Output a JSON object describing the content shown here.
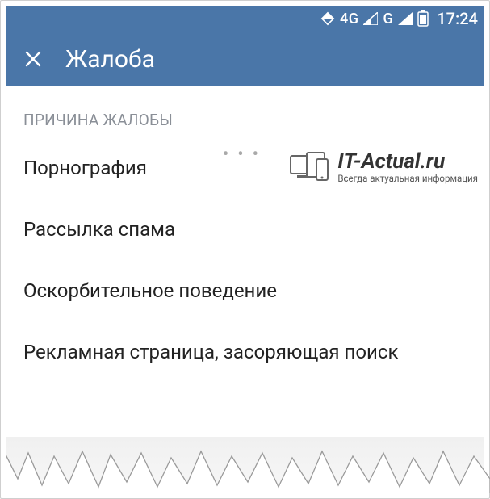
{
  "status": {
    "net1": "4G",
    "net2": "G",
    "time": "17:24"
  },
  "toolbar": {
    "close_glyph": "✕",
    "title": "Жалоба"
  },
  "section_label": "ПРИЧИНА ЖАЛОБЫ",
  "reasons": [
    "Порнография",
    "Рассылка спама",
    "Оскорбительное поведение",
    "Рекламная страница, засоряющая поиск"
  ],
  "watermark": {
    "title": "IT-Actual.ru",
    "sub": "Всегда актуальная информация"
  }
}
